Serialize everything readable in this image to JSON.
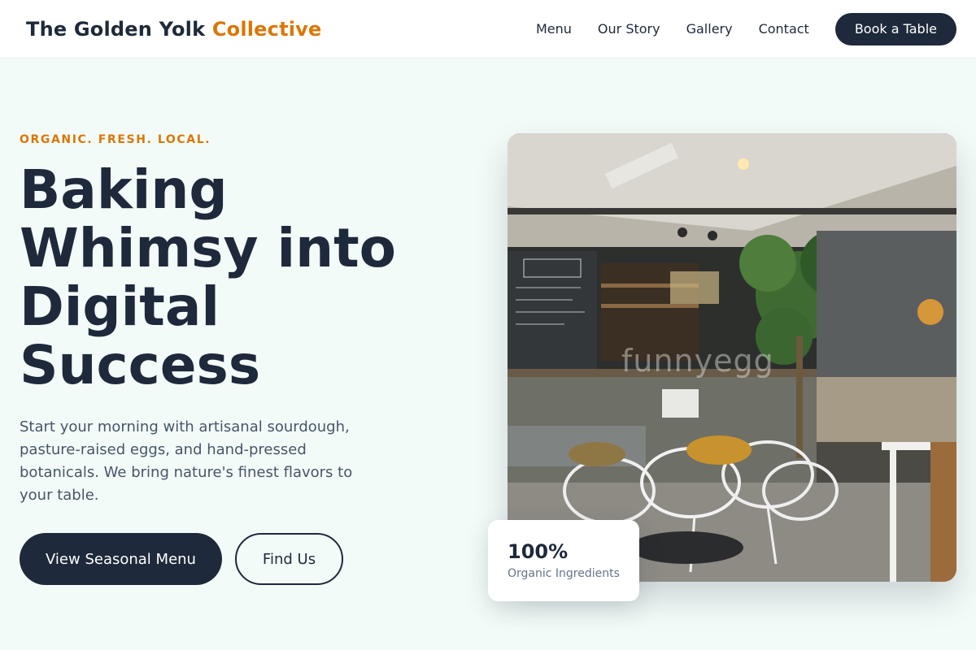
{
  "header": {
    "brand_main": "The Golden Yolk",
    "brand_accent": "Collective",
    "nav": [
      "Menu",
      "Our Story",
      "Gallery",
      "Contact"
    ],
    "cta": "Book a Table"
  },
  "hero": {
    "eyebrow": "ORGANIC. FRESH. LOCAL.",
    "headline_lines": [
      "Baking",
      "Whimsy into",
      "Digital",
      "Success"
    ],
    "lead": "Start your morning with artisanal sourdough, pasture-raised eggs, and hand-pressed botanicals. We bring nature's finest flavors to your table.",
    "primary_button": "View Seasonal Menu",
    "secondary_button": "Find Us"
  },
  "photo": {
    "watermark": "funnyegg"
  },
  "stat": {
    "value": "100%",
    "label": "Organic Ingredients"
  },
  "colors": {
    "accent": "#d97706",
    "dark": "#1e293b",
    "background": "#f3fbf8"
  }
}
